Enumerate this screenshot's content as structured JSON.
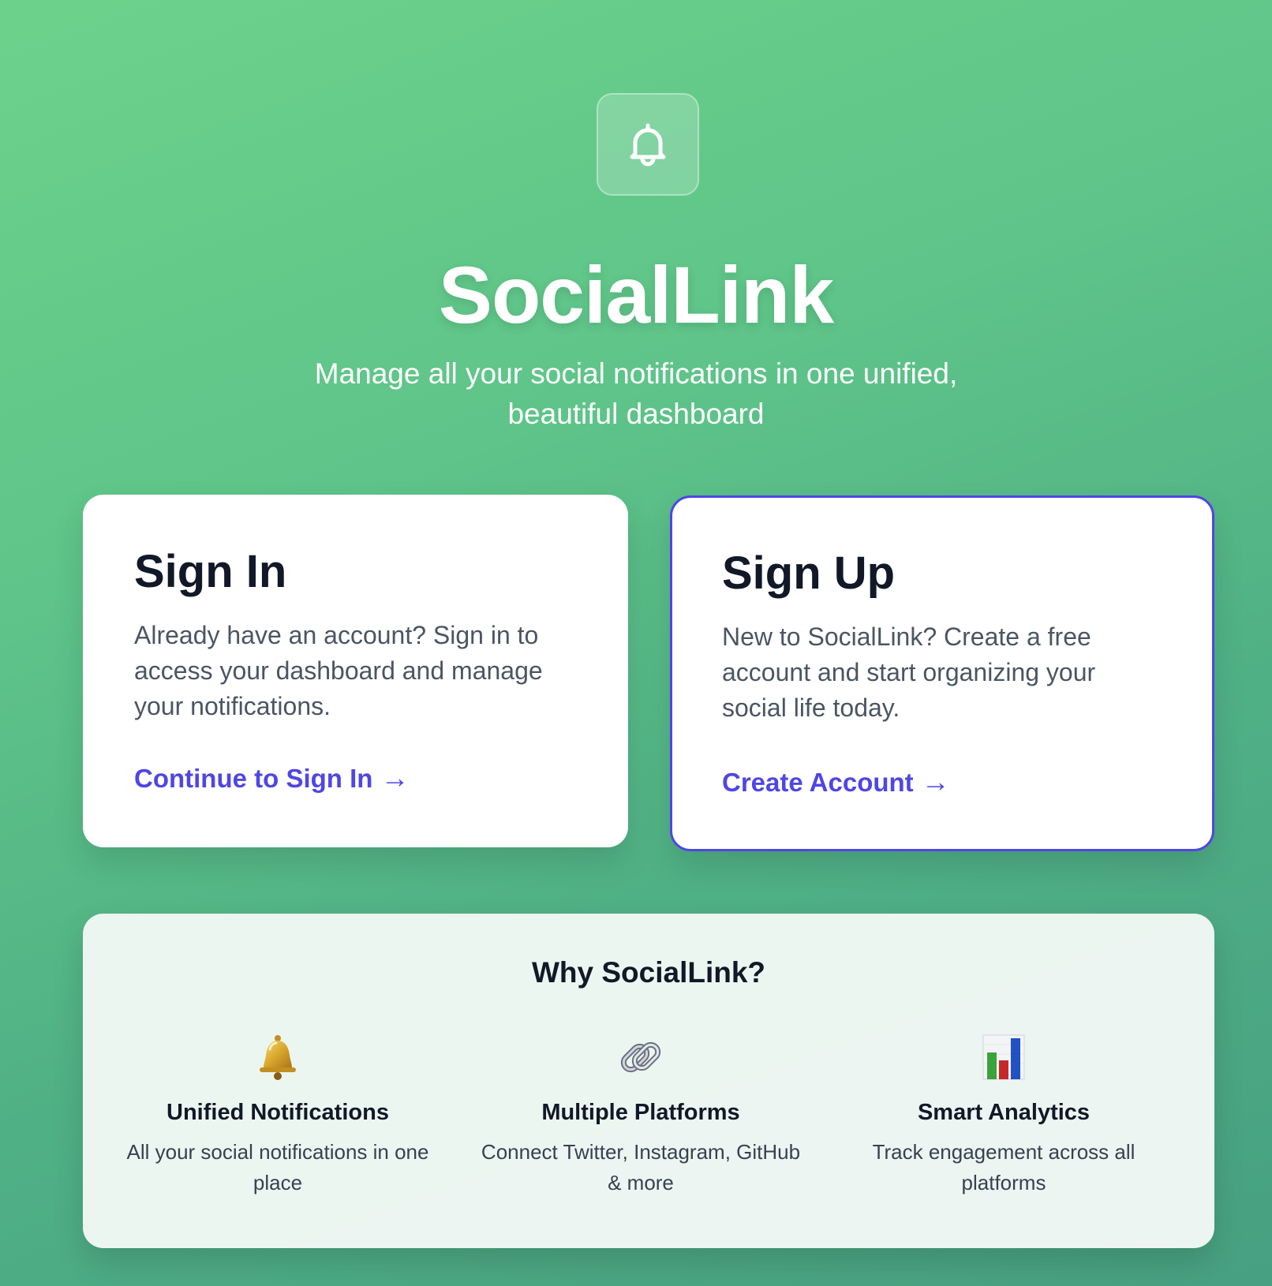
{
  "header": {
    "logo_icon": "bell-icon",
    "title": "SocialLink",
    "subtitle": "Manage all your social notifications in one unified, beautiful dashboard"
  },
  "signin_card": {
    "title": "Sign In",
    "description": "Already have an account? Sign in to access your dashboard and manage your notifications.",
    "link_label": "Continue to Sign In",
    "link_arrow": "→"
  },
  "signup_card": {
    "title": "Sign Up",
    "description": "New to SocialLink? Create a free account and start organizing your social life today.",
    "link_label": "Create Account",
    "link_arrow": "→"
  },
  "features": {
    "title": "Why SocialLink?",
    "items": [
      {
        "icon": "golden-bell-icon",
        "title": "Unified Notifications",
        "description": "All your social notifications in one place"
      },
      {
        "icon": "link-icon",
        "title": "Multiple Platforms",
        "description": "Connect Twitter, Instagram, GitHub & more"
      },
      {
        "icon": "bar-chart-icon",
        "title": "Smart Analytics",
        "description": "Track engagement across all platforms"
      }
    ]
  },
  "colors": {
    "accent": "#4f46e5",
    "background_start": "#6cd28b",
    "background_end": "#47a082",
    "heading": "#111827",
    "body_text": "#4b5563"
  }
}
